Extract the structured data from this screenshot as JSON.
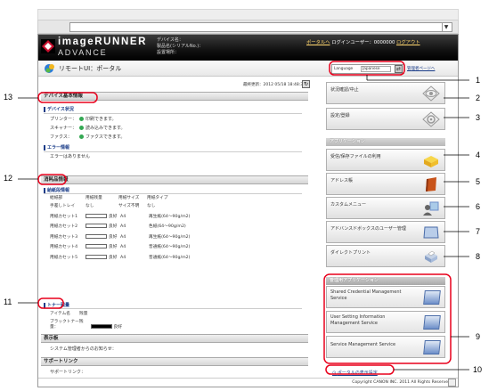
{
  "banner": {
    "brand_line1": "imageRUNNER",
    "brand_line2": "ADVANCE",
    "device_name_label": "デバイス名：",
    "product_label": "製品名(シリアルNo.)：",
    "location_label": "設置場所：",
    "portal_link": "ポータルへ",
    "login_user": "ログインユーザー：0000000",
    "logout": "ログアウト"
  },
  "titlebar": {
    "title": "リモートUI：ポータル",
    "language_label": "Language",
    "language_value": "Japanese",
    "admin_link": "管理者ページへ"
  },
  "last_updated": "最終更新：2012 05/18 18:48:34",
  "device_info": {
    "title": "デバイス基本情報",
    "status_heading": "デバイス状況",
    "status": [
      {
        "label": "プリンター：",
        "value": "印刷できます。"
      },
      {
        "label": "スキャナー：",
        "value": "読み込みできます。"
      },
      {
        "label": "ファクス：",
        "value": "ファクスできます。"
      }
    ],
    "error_heading": "エラー情報",
    "error_text": "エラーはありません"
  },
  "consumables": {
    "title": "消耗品情報",
    "paper_heading": "給紙段情報",
    "columns": [
      "給紙部",
      "用紙残量",
      "用紙サイズ",
      "用紙タイプ"
    ],
    "rows": [
      {
        "source": "手差しトレイ",
        "level": "なし",
        "size": "サイズ不明",
        "type": "なし"
      },
      {
        "source": "用紙カセット1",
        "level": "良好",
        "size": "A4",
        "type": "再生紙(64〜90g/m2)"
      },
      {
        "source": "用紙カセット2",
        "level": "良好",
        "size": "A4",
        "type": "色紙(64〜90g/m2)"
      },
      {
        "source": "用紙カセット3",
        "level": "良好",
        "size": "A4",
        "type": "再生紙(64〜90g/m2)"
      },
      {
        "source": "用紙カセット4",
        "level": "良好",
        "size": "A4",
        "type": "普通紙(64〜90g/m2)"
      },
      {
        "source": "用紙カセット5",
        "level": "良好",
        "size": "A4",
        "type": "普通紙(64〜90g/m2)"
      }
    ],
    "toner_heading": "トナー残量",
    "toner_columns": [
      "アイテム名",
      "残量"
    ],
    "toner_item": "ブラックトナー残量：",
    "toner_level": "良好"
  },
  "notice": {
    "title": "表示板",
    "text": "システム管理者からのお知らせ："
  },
  "support": {
    "title": "サポートリンク",
    "text": "サポートリンク："
  },
  "menu": {
    "status_monitor": "状況確認/中止",
    "settings": "設定/登録",
    "app_heading": "アプリケーション",
    "inbox": "受信/保存ファイルの利用",
    "address_book": "アドレス帳",
    "custom_menu": "カスタムメニュー",
    "advanced_box": "アドバンスドボックスのユーザー管理",
    "direct_print": "ダイレクトプリント",
    "mgmt_heading": "管理用アプリケーション",
    "mgmt_items": [
      {
        "line1": "Shared Credential Management",
        "line2": "Service"
      },
      {
        "line1": "User Setting Information",
        "line2": "Management Service"
      },
      {
        "line1": "Service Management Service",
        "line2": ""
      }
    ],
    "portal_settings": "ポータルの表示設定"
  },
  "copyright": "Copyright CANON INC. 2011 All Rights Reserved",
  "callouts": [
    "1",
    "2",
    "3",
    "4",
    "5",
    "6",
    "7",
    "8",
    "9",
    "10",
    "11",
    "12",
    "13"
  ],
  "colors": {
    "callout": "#e8001c",
    "link": "#1a3c88",
    "ok": "#34a853"
  }
}
